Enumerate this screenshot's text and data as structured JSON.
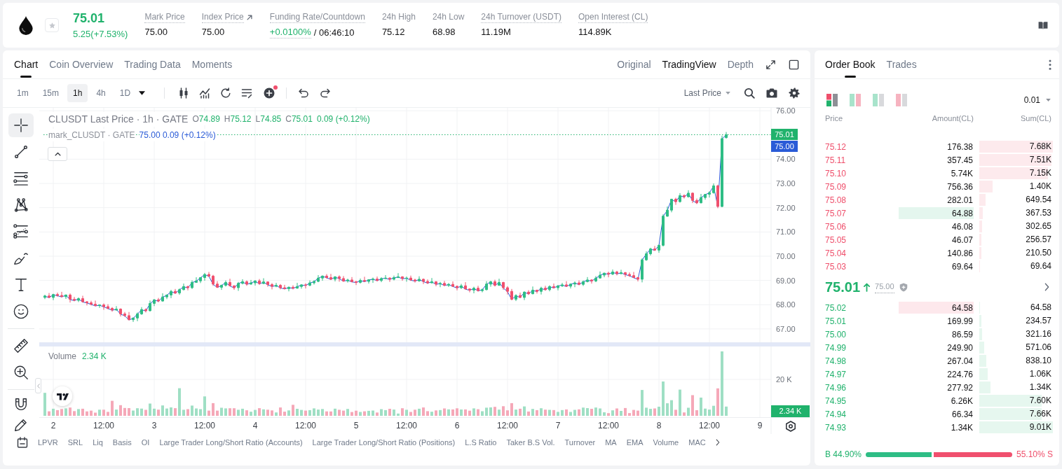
{
  "header": {
    "starred": false,
    "price": "75.01",
    "change": "5.25(+7.53%)",
    "stats": [
      {
        "kind": "plain",
        "hint": true,
        "label": "Mark Price",
        "value": "75.00"
      },
      {
        "kind": "link",
        "hint": true,
        "label": "Index Price",
        "value": "75.00"
      },
      {
        "kind": "funding",
        "hint": true,
        "label": "Funding Rate/Countdown",
        "value": "+0.0100%",
        "countdown": "/ 06:46:10"
      },
      {
        "kind": "plain",
        "hint": false,
        "label": "24h High",
        "value": "75.12"
      },
      {
        "kind": "plain",
        "hint": false,
        "label": "24h Low",
        "value": "68.98"
      },
      {
        "kind": "plain",
        "hint": true,
        "label": "24h Turnover (USDT)",
        "value": "11.19M"
      },
      {
        "kind": "plain",
        "hint": true,
        "label": "Open Interest (CL)",
        "value": "114.89K"
      }
    ]
  },
  "chart_panel": {
    "tabs": [
      {
        "label": "Chart",
        "selected": true
      },
      {
        "label": "Coin Overview",
        "selected": false
      },
      {
        "label": "Trading Data",
        "selected": false
      },
      {
        "label": "Moments",
        "selected": false
      }
    ],
    "views": [
      {
        "label": "Original",
        "selected": false
      },
      {
        "label": "TradingView",
        "selected": true
      },
      {
        "label": "Depth",
        "selected": false
      }
    ],
    "intervals": [
      {
        "label": "1m",
        "selected": false
      },
      {
        "label": "15m",
        "selected": false
      },
      {
        "label": "1h",
        "selected": true
      },
      {
        "label": "4h",
        "selected": false
      },
      {
        "label": "1D",
        "selected": false
      }
    ],
    "indicator_badge": true,
    "price_source": "Last Price",
    "tool_groups": [
      [
        {
          "kind": "crosshair",
          "selected": true
        },
        {
          "kind": "trend-line",
          "selected": false
        },
        {
          "kind": "parallel-lines",
          "selected": false
        },
        {
          "kind": "pattern",
          "selected": false
        },
        {
          "kind": "fibonacci",
          "selected": false
        },
        {
          "kind": "brush",
          "selected": false
        },
        {
          "kind": "text",
          "selected": false
        },
        {
          "kind": "emoji",
          "selected": false
        }
      ],
      [
        {
          "kind": "ruler",
          "selected": false
        },
        {
          "kind": "zoom-in",
          "selected": false
        }
      ],
      [
        {
          "kind": "magnet",
          "selected": false
        },
        {
          "kind": "pencil",
          "selected": false
        }
      ]
    ],
    "legend": {
      "symbol": "CLUSDT Last Price · 1h · GATE",
      "ohlc": [
        {
          "label": "O",
          "value": "74.89"
        },
        {
          "label": "H",
          "value": "75.12"
        },
        {
          "label": "L",
          "value": "74.85"
        },
        {
          "label": "C",
          "value": "75.01"
        }
      ],
      "change": "0.09 (+0.12%)"
    },
    "mark_legend": {
      "symbol": "mark_CLUSDT · GATE",
      "values": "75.00 0.09 (+0.12%)"
    },
    "price_chart": {
      "chart_data": {
        "type": "candlestick",
        "xlim": [
          1.861,
          9.5
        ],
        "ylim": [
          62.667,
          76.12
        ],
        "xticks": [
          2,
          3,
          4,
          5,
          6,
          7,
          8,
          9
        ],
        "yticks": [
          {
            "value": 76,
            "label": "76.00"
          },
          {
            "value": 74,
            "label": "74.00"
          },
          {
            "value": 73,
            "label": "73.00"
          },
          {
            "value": 72,
            "label": "72.00"
          },
          {
            "value": 71,
            "label": "71.00"
          },
          {
            "value": 70,
            "label": "70.00"
          },
          {
            "value": 69,
            "label": "69.00"
          },
          {
            "value": 68,
            "label": "68.00"
          },
          {
            "value": 67,
            "label": "67.00"
          }
        ],
        "x": [
          1.9167,
          1.9583,
          2,
          2.0417,
          2.0833,
          2.125,
          2.1667,
          2.2083,
          2.25,
          2.2917,
          2.3333,
          2.375,
          2.4167,
          2.4583,
          2.5,
          2.5417,
          2.5833,
          2.625,
          2.6667,
          2.7083,
          2.75,
          2.7917,
          2.8333,
          2.875,
          2.9167,
          2.9583,
          3,
          3.0417,
          3.0833,
          3.125,
          3.1667,
          3.2083,
          3.25,
          3.2917,
          3.3333,
          3.375,
          3.4167,
          3.4583,
          3.5,
          3.5417,
          3.5833,
          3.625,
          3.6667,
          3.7083,
          3.75,
          3.7917,
          3.8333,
          3.875,
          3.9167,
          3.9583,
          4,
          4.0417,
          4.0833,
          4.125,
          4.1667,
          4.2083,
          4.25,
          4.2917,
          4.3333,
          4.375,
          4.4167,
          4.4583,
          4.5,
          4.5417,
          4.5833,
          4.625,
          4.6667,
          4.7083,
          4.75,
          4.7917,
          4.8333,
          4.875,
          4.9167,
          4.9583,
          5,
          5.0417,
          5.0833,
          5.125,
          5.1667,
          5.2083,
          5.25,
          5.2917,
          5.3333,
          5.375,
          5.4167,
          5.4583,
          5.5,
          5.5417,
          5.5833,
          5.625,
          5.6667,
          5.7083,
          5.75,
          5.7917,
          5.8333,
          5.875,
          5.9167,
          5.9583,
          6,
          6.0417,
          6.0833,
          6.125,
          6.1667,
          6.2083,
          6.25,
          6.2917,
          6.3333,
          6.375,
          6.4167,
          6.4583,
          6.5,
          6.5417,
          6.5833,
          6.625,
          6.6667,
          6.7083,
          6.75,
          6.7917,
          6.8333,
          6.875,
          6.9167,
          6.9583,
          7,
          7.0417,
          7.0833,
          7.125,
          7.1667,
          7.2083,
          7.25,
          7.2917,
          7.3333,
          7.375,
          7.4167,
          7.4583,
          7.5,
          7.5417,
          7.5833,
          7.625,
          7.6667,
          7.7083,
          7.75,
          7.7917,
          7.8333,
          7.875,
          7.9167,
          7.9583,
          8,
          8.0417,
          8.0833,
          8.125,
          8.1667,
          8.2083,
          8.25,
          8.2917,
          8.3333,
          8.375,
          8.4167,
          8.4583,
          8.5,
          8.5417,
          8.5833,
          8.625,
          8.6667
        ],
        "ohlc": [
          [
            68.3,
            68.41,
            68.23,
            68.36
          ],
          [
            68.36,
            68.48,
            68.27,
            68.3
          ],
          [
            68.3,
            68.45,
            68.19,
            68.42
          ],
          [
            68.42,
            68.5,
            68.33,
            68.38
          ],
          [
            68.38,
            68.53,
            68.31,
            68.33
          ],
          [
            68.33,
            68.42,
            68.24,
            68.4
          ],
          [
            68.4,
            68.46,
            68.09,
            68.22
          ],
          [
            68.22,
            68.32,
            68.14,
            68.18
          ],
          [
            68.18,
            68.3,
            68.11,
            68.25
          ],
          [
            68.25,
            68.37,
            68.09,
            68.12
          ],
          [
            68.12,
            68.15,
            67.97,
            68.08
          ],
          [
            68.08,
            68.16,
            67.97,
            68.02
          ],
          [
            68.02,
            68.17,
            67.94,
            67.96
          ],
          [
            67.96,
            68.01,
            67.87,
            67.99
          ],
          [
            67.99,
            68.05,
            67.79,
            67.92
          ],
          [
            67.92,
            68.02,
            67.81,
            67.85
          ],
          [
            67.85,
            67.9,
            67.71,
            67.78
          ],
          [
            67.78,
            67.94,
            67.75,
            67.82
          ],
          [
            67.82,
            67.85,
            67.51,
            67.62
          ],
          [
            67.62,
            67.7,
            67.5,
            67.55
          ],
          [
            67.55,
            67.7,
            67.36,
            67.38
          ],
          [
            67.38,
            67.47,
            67.29,
            67.45
          ],
          [
            67.45,
            67.68,
            67.32,
            67.62
          ],
          [
            67.62,
            67.9,
            67.58,
            67.8
          ],
          [
            67.8,
            67.85,
            67.68,
            67.75
          ],
          [
            67.75,
            68.17,
            67.72,
            68.05
          ],
          [
            68.05,
            68.23,
            67.94,
            68.2
          ],
          [
            68.2,
            68.28,
            68.1,
            68.15
          ],
          [
            68.15,
            68.47,
            68.13,
            68.32
          ],
          [
            68.32,
            68.42,
            68.23,
            68.4
          ],
          [
            68.4,
            68.61,
            68.27,
            68.55
          ],
          [
            68.55,
            68.65,
            68.44,
            68.48
          ],
          [
            68.48,
            68.67,
            68.41,
            68.62
          ],
          [
            68.62,
            68.87,
            68.59,
            68.75
          ],
          [
            68.75,
            68.78,
            68.59,
            68.7
          ],
          [
            68.7,
            69.0,
            68.65,
            68.92
          ],
          [
            68.92,
            69.13,
            68.9,
            68.98
          ],
          [
            68.98,
            69.14,
            68.89,
            69.12
          ],
          [
            69.12,
            69.31,
            68.99,
            69.25
          ],
          [
            69.25,
            69.35,
            69.14,
            69.18
          ],
          [
            69.18,
            69.23,
            68.78,
            68.85
          ],
          [
            68.85,
            68.97,
            68.69,
            68.72
          ],
          [
            68.72,
            68.83,
            68.61,
            68.8
          ],
          [
            68.8,
            69.0,
            68.75,
            68.92
          ],
          [
            68.92,
            69.07,
            68.76,
            68.78
          ],
          [
            68.78,
            68.8,
            68.61,
            68.7
          ],
          [
            68.7,
            68.94,
            68.57,
            68.88
          ],
          [
            68.88,
            69.05,
            68.84,
            68.95
          ],
          [
            68.95,
            69.0,
            68.78,
            68.85
          ],
          [
            68.85,
            69.02,
            68.82,
            68.9
          ],
          [
            68.9,
            69.01,
            68.79,
            68.98
          ],
          [
            68.98,
            69.06,
            68.82,
            68.87
          ],
          [
            68.87,
            69.09,
            68.85,
            68.94
          ],
          [
            68.94,
            68.96,
            68.74,
            68.83
          ],
          [
            68.83,
            68.89,
            68.63,
            68.76
          ],
          [
            68.76,
            68.9,
            68.72,
            68.8
          ],
          [
            68.8,
            68.85,
            68.63,
            68.7
          ],
          [
            68.7,
            68.82,
            68.63,
            68.66
          ],
          [
            68.66,
            68.75,
            68.55,
            68.72
          ],
          [
            68.72,
            68.8,
            68.63,
            68.68
          ],
          [
            68.68,
            68.9,
            68.66,
            68.75
          ],
          [
            68.75,
            68.84,
            68.66,
            68.82
          ],
          [
            68.82,
            68.88,
            68.67,
            68.8
          ],
          [
            68.8,
            69.0,
            68.76,
            68.9
          ],
          [
            68.9,
            69.01,
            68.83,
            68.96
          ],
          [
            68.96,
            69.22,
            68.93,
            69.1
          ],
          [
            69.1,
            69.21,
            68.99,
            69.18
          ],
          [
            69.18,
            69.26,
            69.07,
            69.12
          ],
          [
            69.12,
            69.27,
            69.03,
            69.05
          ],
          [
            69.05,
            69.17,
            68.96,
            69.15
          ],
          [
            69.15,
            69.21,
            68.95,
            69.08
          ],
          [
            69.08,
            69.18,
            68.94,
            68.98
          ],
          [
            68.98,
            69.07,
            68.91,
            69.02
          ],
          [
            69.02,
            69.14,
            68.92,
            68.95
          ],
          [
            68.95,
            68.98,
            68.81,
            68.92
          ],
          [
            68.92,
            69.08,
            68.87,
            69.0
          ],
          [
            69.0,
            69.15,
            68.94,
            68.96
          ],
          [
            68.96,
            69.05,
            68.87,
            69.03
          ],
          [
            69.03,
            69.12,
            68.9,
            69.06
          ],
          [
            69.06,
            69.16,
            68.96,
            69.0
          ],
          [
            69.0,
            69.13,
            68.93,
            69.08
          ],
          [
            69.08,
            69.22,
            69.05,
            69.1
          ],
          [
            69.1,
            69.13,
            68.94,
            69.05
          ],
          [
            69.05,
            69.2,
            69.0,
            69.12
          ],
          [
            69.12,
            69.3,
            69.1,
            69.15
          ],
          [
            69.15,
            69.17,
            68.99,
            69.08
          ],
          [
            69.08,
            69.16,
            68.95,
            69.1
          ],
          [
            69.1,
            69.2,
            68.98,
            69.02
          ],
          [
            69.02,
            69.07,
            68.91,
            68.98
          ],
          [
            68.98,
            69.17,
            68.95,
            69.05
          ],
          [
            69.05,
            69.08,
            68.85,
            68.96
          ],
          [
            68.96,
            69.04,
            68.85,
            68.9
          ],
          [
            68.9,
            69.1,
            68.88,
            68.95
          ],
          [
            68.95,
            68.97,
            68.76,
            68.85
          ],
          [
            68.85,
            68.94,
            68.72,
            68.88
          ],
          [
            68.88,
            68.98,
            68.76,
            68.8
          ],
          [
            68.8,
            68.89,
            68.73,
            68.84
          ],
          [
            68.84,
            68.96,
            68.73,
            68.76
          ],
          [
            68.76,
            68.79,
            68.59,
            68.7
          ],
          [
            68.7,
            68.86,
            68.65,
            68.78
          ],
          [
            68.78,
            68.93,
            68.63,
            68.65
          ],
          [
            68.65,
            68.67,
            68.51,
            68.6
          ],
          [
            68.6,
            68.74,
            68.47,
            68.68
          ],
          [
            68.68,
            68.78,
            68.54,
            68.58
          ],
          [
            68.58,
            68.67,
            68.51,
            68.62
          ],
          [
            68.62,
            68.97,
            68.59,
            68.85
          ],
          [
            68.85,
            68.98,
            68.74,
            68.95
          ],
          [
            68.95,
            69.03,
            68.75,
            68.8
          ],
          [
            68.8,
            69.07,
            68.78,
            68.92
          ],
          [
            68.92,
            68.94,
            68.61,
            68.7
          ],
          [
            68.7,
            68.76,
            68.42,
            68.55
          ],
          [
            68.55,
            68.65,
            68.18,
            68.22
          ],
          [
            68.22,
            68.43,
            68.15,
            68.38
          ],
          [
            68.38,
            68.5,
            68.27,
            68.3
          ],
          [
            68.3,
            68.55,
            68.19,
            68.52
          ],
          [
            68.52,
            68.6,
            68.4,
            68.45
          ],
          [
            68.45,
            68.75,
            68.43,
            68.6
          ],
          [
            68.6,
            68.62,
            68.46,
            68.55
          ],
          [
            68.55,
            68.74,
            68.42,
            68.68
          ],
          [
            68.68,
            68.78,
            68.58,
            68.62
          ],
          [
            68.62,
            68.8,
            68.55,
            68.75
          ],
          [
            68.75,
            68.87,
            68.67,
            68.7
          ],
          [
            68.7,
            68.81,
            68.59,
            68.78
          ],
          [
            68.78,
            68.9,
            68.73,
            68.82
          ],
          [
            68.82,
            68.97,
            68.74,
            68.76
          ],
          [
            68.76,
            68.87,
            68.67,
            68.85
          ],
          [
            68.85,
            68.96,
            68.72,
            68.9
          ],
          [
            68.9,
            69.0,
            68.8,
            68.84
          ],
          [
            68.84,
            69.0,
            68.77,
            68.95
          ],
          [
            68.95,
            69.14,
            68.92,
            69.02
          ],
          [
            69.02,
            69.05,
            68.87,
            68.98
          ],
          [
            68.98,
            69.18,
            68.93,
            69.1
          ],
          [
            69.1,
            69.37,
            69.08,
            69.22
          ],
          [
            69.22,
            69.32,
            69.13,
            69.3
          ],
          [
            69.3,
            69.36,
            69.13,
            69.26
          ],
          [
            69.26,
            69.45,
            69.22,
            69.35
          ],
          [
            69.35,
            69.4,
            69.21,
            69.28
          ],
          [
            69.28,
            69.44,
            69.25,
            69.32
          ],
          [
            69.32,
            69.35,
            69.14,
            69.25
          ],
          [
            69.25,
            69.33,
            69.15,
            69.2
          ],
          [
            69.2,
            69.35,
            69.1,
            69.12
          ],
          [
            69.12,
            69.14,
            68.96,
            69.05
          ],
          [
            69.05,
            69.91,
            68.92,
            69.85
          ],
          [
            69.85,
            70.2,
            69.81,
            70.1
          ],
          [
            70.1,
            70.35,
            70.03,
            70.3
          ],
          [
            70.3,
            70.42,
            70.22,
            70.25
          ],
          [
            70.25,
            70.48,
            70.14,
            70.45
          ],
          [
            70.45,
            71.73,
            70.4,
            71.65
          ],
          [
            71.65,
            72.05,
            71.63,
            71.9
          ],
          [
            71.9,
            72.37,
            71.81,
            72.35
          ],
          [
            72.35,
            72.41,
            72.12,
            72.25
          ],
          [
            72.25,
            72.6,
            72.21,
            72.5
          ],
          [
            72.5,
            72.55,
            72.38,
            72.45
          ],
          [
            72.45,
            72.72,
            72.42,
            72.6
          ],
          [
            72.6,
            72.63,
            72.19,
            72.3
          ],
          [
            72.3,
            72.38,
            72.15,
            72.2
          ],
          [
            72.2,
            72.57,
            72.18,
            72.42
          ],
          [
            72.42,
            72.57,
            72.33,
            72.55
          ],
          [
            72.55,
            72.68,
            72.42,
            72.62
          ],
          [
            72.62,
            73.0,
            72.58,
            72.9
          ],
          [
            72.9,
            72.95,
            71.98,
            72.05
          ],
          [
            72.05,
            74.97,
            72.02,
            74.85
          ],
          [
            74.89,
            75.12,
            74.85,
            75.01
          ]
        ]
      }
    },
    "price_axis": {
      "last_price": "75.01",
      "mark_price": "75.00"
    },
    "volume": {
      "label": "Volume",
      "value": "2.34 K",
      "tick": "20 K",
      "current": "2.34 K"
    },
    "time_axis_midday": [
      "12:00",
      "12:00",
      "12:00",
      "12:00",
      "12:00",
      "12:00",
      "12:00"
    ],
    "indicators": [
      "LPVR",
      "SRL",
      "Liq",
      "Basis",
      "OI",
      "Large Trader Long/Short Ratio (Accounts)",
      "Large Trader Long/Short Ratio (Positions)",
      "L.S Ratio",
      "Taker B.S Vol.",
      "Turnover",
      "MA",
      "EMA",
      "Volume",
      "MAC"
    ]
  },
  "order_book": {
    "tabs": [
      {
        "label": "Order Book",
        "selected": true
      },
      {
        "label": "Trades",
        "selected": false
      }
    ],
    "layouts": [
      {
        "kind": "combined",
        "selected": true
      },
      {
        "kind": "bids-asks",
        "selected": false
      },
      {
        "kind": "bids",
        "selected": false
      },
      {
        "kind": "asks",
        "selected": false
      }
    ],
    "precision": "0.01",
    "columns": [
      "Price",
      "Amount(CL)",
      "Sum(CL)"
    ],
    "asks": [
      {
        "price": "75.12",
        "amount": "176.38",
        "sum": "7.68K",
        "level": 1.0,
        "flash": false
      },
      {
        "price": "75.11",
        "amount": "357.45",
        "sum": "7.51K",
        "level": 0.978,
        "flash": false
      },
      {
        "price": "75.10",
        "amount": "5.74K",
        "sum": "7.15K",
        "level": 0.931,
        "flash": false
      },
      {
        "price": "75.09",
        "amount": "756.36",
        "sum": "1.40K",
        "level": 0.182,
        "flash": false
      },
      {
        "price": "75.08",
        "amount": "282.01",
        "sum": "649.54",
        "level": 0.085,
        "flash": false
      },
      {
        "price": "75.07",
        "amount": "64.88",
        "sum": "367.53",
        "level": 0.048,
        "flash": true
      },
      {
        "price": "75.06",
        "amount": "46.08",
        "sum": "302.65",
        "level": 0.039,
        "flash": false
      },
      {
        "price": "75.05",
        "amount": "46.07",
        "sum": "256.57",
        "level": 0.033,
        "flash": false
      },
      {
        "price": "75.04",
        "amount": "140.86",
        "sum": "210.50",
        "level": 0.027,
        "flash": false
      },
      {
        "price": "75.03",
        "amount": "69.64",
        "sum": "69.64",
        "level": 0.009,
        "flash": false
      }
    ],
    "last": {
      "price": "75.01",
      "up": true,
      "mark": "75.00"
    },
    "bids": [
      {
        "price": "75.02",
        "amount": "64.58",
        "sum": "64.58",
        "level": 0.007,
        "flash": true
      },
      {
        "price": "75.01",
        "amount": "169.99",
        "sum": "234.57",
        "level": 0.026,
        "flash": false
      },
      {
        "price": "75.00",
        "amount": "86.59",
        "sum": "321.16",
        "level": 0.036,
        "flash": false
      },
      {
        "price": "74.99",
        "amount": "249.90",
        "sum": "571.06",
        "level": 0.063,
        "flash": false
      },
      {
        "price": "74.98",
        "amount": "267.04",
        "sum": "838.10",
        "level": 0.093,
        "flash": false
      },
      {
        "price": "74.97",
        "amount": "224.76",
        "sum": "1.06K",
        "level": 0.118,
        "flash": false
      },
      {
        "price": "74.96",
        "amount": "277.92",
        "sum": "1.34K",
        "level": 0.149,
        "flash": false
      },
      {
        "price": "74.95",
        "amount": "6.26K",
        "sum": "7.60K",
        "level": 0.844,
        "flash": false
      },
      {
        "price": "74.94",
        "amount": "66.34",
        "sum": "7.66K",
        "level": 0.85,
        "flash": false
      },
      {
        "price": "74.93",
        "amount": "1.34K",
        "sum": "9.01K",
        "level": 1.0,
        "flash": false
      }
    ],
    "ratio": {
      "buy": "B 44.90%",
      "sell": "55.10% S",
      "level": 0.449
    }
  }
}
